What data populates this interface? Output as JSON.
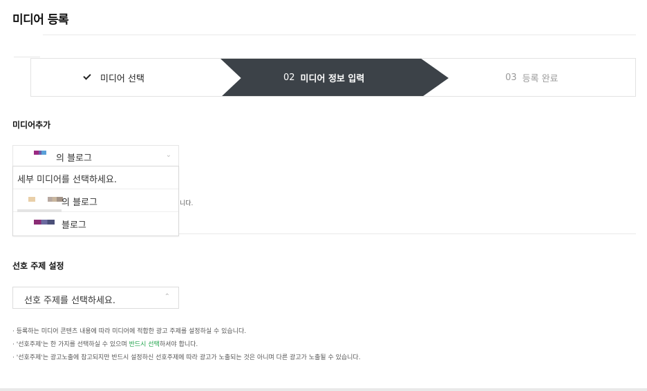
{
  "page": {
    "title": "미디어 등록"
  },
  "stepper": {
    "step1": {
      "label": "미디어 선택"
    },
    "step2": {
      "num": "02",
      "label": "미디어 정보 입력"
    },
    "step3": {
      "num": "03",
      "label": "등록 완료"
    }
  },
  "media_section": {
    "label": "미디어추가",
    "select": {
      "selected": "의 블로그",
      "icon": "chevron-down-icon"
    },
    "options": [
      "세부 미디어를 선택하세요.",
      "의 블로그",
      "블로그"
    ],
    "hidden_note_tail": "니다."
  },
  "topic_section": {
    "label": "선호 주제 설정",
    "select": {
      "placeholder": "선호 주제를 선택하세요.",
      "icon": "chevron-up-icon"
    },
    "notes": {
      "line1": "· 등록하는 미디어 콘텐츠 내용에 따라 미디어에 적합한 광고 주제를 설정하실 수 있습니다.",
      "line2_pre": "· '선호주제'는 한 가지를 선택하실 수 있으며 ",
      "line2_em": "반드시 선택",
      "line2_post": "하셔야 합니다.",
      "line3": "· '선호주제'는 광고노출에 참고되지만 반드시 설정하신 선호주제에 따라 광고가 노출되는 것은 아니며 다른 광고가 노출될 수 있습니다."
    }
  },
  "colors": {
    "active_step": "#3c4248",
    "emphasis": "#1fa34a",
    "inactive_step": "#9a9a9a"
  }
}
